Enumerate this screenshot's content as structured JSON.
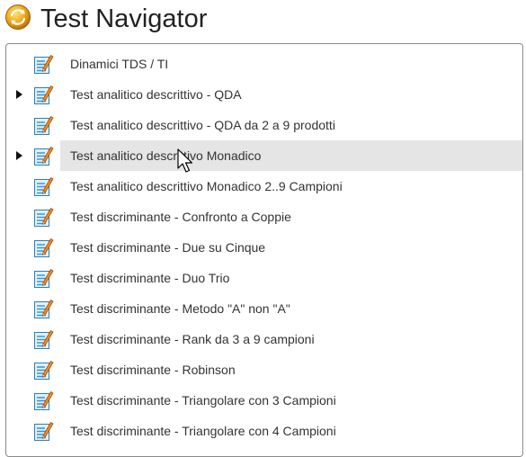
{
  "window": {
    "title": "Test Navigator",
    "logo_icon": "refresh-circle-icon",
    "accent": "#e8a317"
  },
  "tree": {
    "item_icon": "edit-document-icon",
    "hover_color": "#e5e5e5",
    "items": [
      {
        "label": "Dinamici TDS / TI",
        "expandable": false,
        "hovered": false
      },
      {
        "label": "Test analitico descrittivo - QDA",
        "expandable": true,
        "hovered": false
      },
      {
        "label": "Test analitico descrittivo - QDA da 2 a 9 prodotti",
        "expandable": false,
        "hovered": false
      },
      {
        "label": "Test analitico descrittivo Monadico",
        "expandable": true,
        "hovered": true
      },
      {
        "label": "Test analitico descrittivo Monadico 2..9 Campioni",
        "expandable": false,
        "hovered": false
      },
      {
        "label": "Test discriminante - Confronto a Coppie",
        "expandable": false,
        "hovered": false
      },
      {
        "label": "Test discriminante - Due su Cinque",
        "expandable": false,
        "hovered": false
      },
      {
        "label": "Test discriminante - Duo Trio",
        "expandable": false,
        "hovered": false
      },
      {
        "label": "Test discriminante - Metodo \"A\" non \"A\"",
        "expandable": false,
        "hovered": false
      },
      {
        "label": "Test discriminante - Rank da 3 a 9 campioni",
        "expandable": false,
        "hovered": false
      },
      {
        "label": "Test discriminante - Robinson",
        "expandable": false,
        "hovered": false
      },
      {
        "label": "Test discriminante - Triangolare con 3 Campioni",
        "expandable": false,
        "hovered": false
      },
      {
        "label": "Test discriminante - Triangolare con 4 Campioni",
        "expandable": false,
        "hovered": false
      }
    ]
  }
}
